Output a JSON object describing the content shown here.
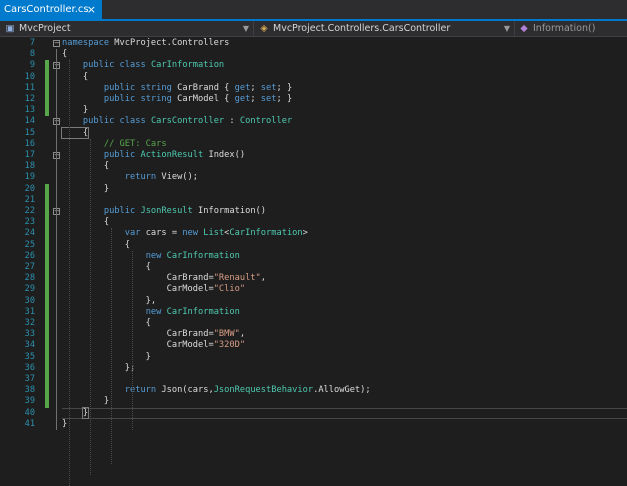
{
  "tab": {
    "title": "CarsController.cs",
    "close_glyph": "×"
  },
  "nav": {
    "project": "MvcProject",
    "class": "MvcProject.Controllers.CarsController",
    "member": "Information()"
  },
  "colors": {
    "keyword": "#569cd6",
    "type": "#4ec9b0",
    "string": "#d69d85",
    "comment": "#57a64a",
    "plain": "#dcdcdc",
    "line_number": "#2b91af",
    "accent": "#007acc"
  },
  "lines": [
    {
      "n": "7",
      "tokens": [
        [
          "kw",
          "namespace"
        ],
        [
          "pl",
          " MvcProject.Controllers"
        ]
      ]
    },
    {
      "n": "8",
      "tokens": [
        [
          "pl",
          "{"
        ]
      ]
    },
    {
      "n": "9",
      "tokens": [
        [
          "pl",
          "    "
        ],
        [
          "kw",
          "public"
        ],
        [
          "pl",
          " "
        ],
        [
          "kw",
          "class"
        ],
        [
          "pl",
          " "
        ],
        [
          "ty",
          "CarInformation"
        ]
      ]
    },
    {
      "n": "10",
      "tokens": [
        [
          "pl",
          "    {"
        ]
      ]
    },
    {
      "n": "11",
      "tokens": [
        [
          "pl",
          "        "
        ],
        [
          "kw",
          "public"
        ],
        [
          "pl",
          " "
        ],
        [
          "kw",
          "string"
        ],
        [
          "pl",
          " CarBrand { "
        ],
        [
          "kw",
          "get"
        ],
        [
          "pl",
          "; "
        ],
        [
          "kw",
          "set"
        ],
        [
          "pl",
          "; }"
        ]
      ]
    },
    {
      "n": "12",
      "tokens": [
        [
          "pl",
          "        "
        ],
        [
          "kw",
          "public"
        ],
        [
          "pl",
          " "
        ],
        [
          "kw",
          "string"
        ],
        [
          "pl",
          " CarModel { "
        ],
        [
          "kw",
          "get"
        ],
        [
          "pl",
          "; "
        ],
        [
          "kw",
          "set"
        ],
        [
          "pl",
          "; }"
        ]
      ]
    },
    {
      "n": "13",
      "tokens": [
        [
          "pl",
          "    }"
        ]
      ]
    },
    {
      "n": "14",
      "tokens": [
        [
          "pl",
          "    "
        ],
        [
          "kw",
          "public"
        ],
        [
          "pl",
          " "
        ],
        [
          "kw",
          "class"
        ],
        [
          "pl",
          " "
        ],
        [
          "ty",
          "CarsController"
        ],
        [
          "pl",
          " : "
        ],
        [
          "ty",
          "Controller"
        ]
      ]
    },
    {
      "n": "15",
      "tokens": [
        [
          "pl",
          "    {"
        ]
      ]
    },
    {
      "n": "16",
      "tokens": [
        [
          "pl",
          "        "
        ],
        [
          "cm",
          "// GET: Cars"
        ]
      ]
    },
    {
      "n": "17",
      "tokens": [
        [
          "pl",
          "        "
        ],
        [
          "kw",
          "public"
        ],
        [
          "pl",
          " "
        ],
        [
          "ty",
          "ActionResult"
        ],
        [
          "pl",
          " Index()"
        ]
      ]
    },
    {
      "n": "18",
      "tokens": [
        [
          "pl",
          "        {"
        ]
      ]
    },
    {
      "n": "19",
      "tokens": [
        [
          "pl",
          "            "
        ],
        [
          "kw",
          "return"
        ],
        [
          "pl",
          " View();"
        ]
      ]
    },
    {
      "n": "20",
      "tokens": [
        [
          "pl",
          "        }"
        ]
      ]
    },
    {
      "n": "21",
      "tokens": []
    },
    {
      "n": "22",
      "tokens": [
        [
          "pl",
          "        "
        ],
        [
          "kw",
          "public"
        ],
        [
          "pl",
          " "
        ],
        [
          "ty",
          "JsonResult"
        ],
        [
          "pl",
          " Information()"
        ]
      ]
    },
    {
      "n": "23",
      "tokens": [
        [
          "pl",
          "        {"
        ]
      ]
    },
    {
      "n": "24",
      "tokens": [
        [
          "pl",
          "            "
        ],
        [
          "kw",
          "var"
        ],
        [
          "pl",
          " cars = "
        ],
        [
          "kw",
          "new"
        ],
        [
          "pl",
          " "
        ],
        [
          "ty",
          "List"
        ],
        [
          "pl",
          "<"
        ],
        [
          "ty",
          "CarInformation"
        ],
        [
          "pl",
          ">"
        ]
      ]
    },
    {
      "n": "25",
      "tokens": [
        [
          "pl",
          "            {"
        ]
      ]
    },
    {
      "n": "26",
      "tokens": [
        [
          "pl",
          "                "
        ],
        [
          "kw",
          "new"
        ],
        [
          "pl",
          " "
        ],
        [
          "ty",
          "CarInformation"
        ]
      ]
    },
    {
      "n": "27",
      "tokens": [
        [
          "pl",
          "                {"
        ]
      ]
    },
    {
      "n": "28",
      "tokens": [
        [
          "pl",
          "                    CarBrand="
        ],
        [
          "str",
          "\"Renault\""
        ],
        [
          "pl",
          ","
        ]
      ]
    },
    {
      "n": "29",
      "tokens": [
        [
          "pl",
          "                    CarModel="
        ],
        [
          "str",
          "\"Clio\""
        ]
      ]
    },
    {
      "n": "30",
      "tokens": [
        [
          "pl",
          "                },"
        ]
      ]
    },
    {
      "n": "31",
      "tokens": [
        [
          "pl",
          "                "
        ],
        [
          "kw",
          "new"
        ],
        [
          "pl",
          " "
        ],
        [
          "ty",
          "CarInformation"
        ]
      ]
    },
    {
      "n": "32",
      "tokens": [
        [
          "pl",
          "                {"
        ]
      ]
    },
    {
      "n": "33",
      "tokens": [
        [
          "pl",
          "                    CarBrand="
        ],
        [
          "str",
          "\"BMW\""
        ],
        [
          "pl",
          ","
        ]
      ]
    },
    {
      "n": "34",
      "tokens": [
        [
          "pl",
          "                    CarModel="
        ],
        [
          "str",
          "\"320D\""
        ]
      ]
    },
    {
      "n": "35",
      "tokens": [
        [
          "pl",
          "                }"
        ]
      ]
    },
    {
      "n": "36",
      "tokens": [
        [
          "pl",
          "            };"
        ]
      ]
    },
    {
      "n": "37",
      "tokens": []
    },
    {
      "n": "38",
      "tokens": [
        [
          "pl",
          "            "
        ],
        [
          "kw",
          "return"
        ],
        [
          "pl",
          " Json(cars,"
        ],
        [
          "ty",
          "JsonRequestBehavior"
        ],
        [
          "pl",
          ".AllowGet);"
        ]
      ]
    },
    {
      "n": "39",
      "tokens": [
        [
          "pl",
          "        }"
        ]
      ]
    },
    {
      "n": "40",
      "tokens": [
        [
          "pl",
          "    "
        ],
        [
          "pl",
          "}"
        ]
      ]
    },
    {
      "n": "41",
      "tokens": [
        [
          "pl",
          "}"
        ]
      ]
    }
  ]
}
